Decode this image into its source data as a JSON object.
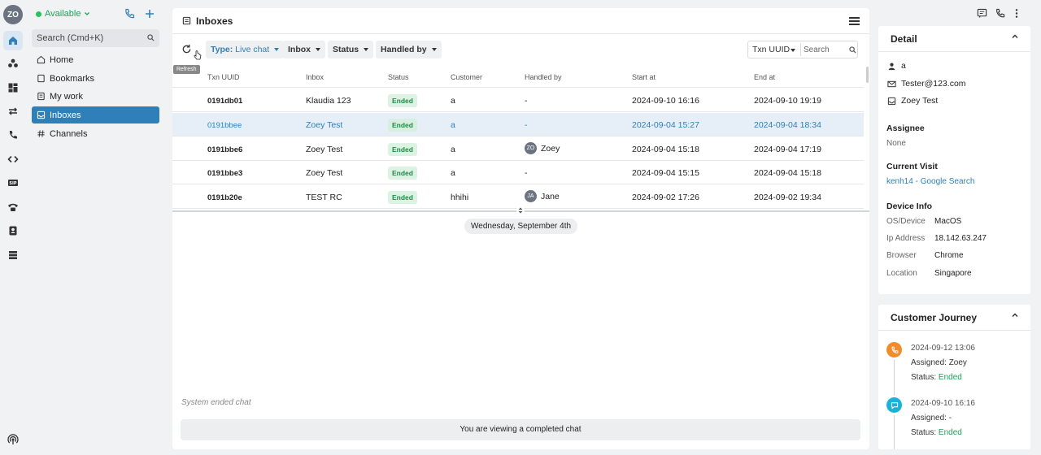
{
  "user": {
    "initials": "ZO",
    "status": "Available"
  },
  "search": {
    "placeholder": "Search (Cmd+K)"
  },
  "nav": {
    "items": [
      {
        "label": "Home",
        "icon": "home-icon"
      },
      {
        "label": "Bookmarks",
        "icon": "bookmark-icon"
      },
      {
        "label": "My work",
        "icon": "briefcase-icon"
      },
      {
        "label": "Inboxes",
        "icon": "inbox-icon"
      },
      {
        "label": "Channels",
        "icon": "hash-icon"
      }
    ]
  },
  "main": {
    "title": "Inboxes",
    "filters": {
      "type_prefix": "Type:",
      "type_value": "Live chat",
      "inbox": "Inbox",
      "status": "Status",
      "handled_by": "Handled by"
    },
    "refresh_tooltip": "Refresh",
    "search_field": {
      "select_label": "Txn UUID",
      "placeholder": "Search"
    },
    "columns": [
      "Txn UUID",
      "Inbox",
      "Status",
      "Customer",
      "Handled by",
      "Start at",
      "End at"
    ],
    "rows": [
      {
        "uuid": "0191db01",
        "inbox": "Klaudia 123",
        "status": "Ended",
        "customer": "a",
        "handled_by": "-",
        "handled_initials": "",
        "start": "2024-09-10 16:16",
        "end": "2024-09-10 19:19"
      },
      {
        "uuid": "0191bbee",
        "inbox": "Zoey Test",
        "status": "Ended",
        "customer": "a",
        "handled_by": "-",
        "handled_initials": "",
        "start": "2024-09-04 15:27",
        "end": "2024-09-04 18:34"
      },
      {
        "uuid": "0191bbe6",
        "inbox": "Zoey Test",
        "status": "Ended",
        "customer": "a",
        "handled_by": "Zoey",
        "handled_initials": "ZO",
        "start": "2024-09-04 15:18",
        "end": "2024-09-04 17:19"
      },
      {
        "uuid": "0191bbe3",
        "inbox": "Zoey Test",
        "status": "Ended",
        "customer": "a",
        "handled_by": "-",
        "handled_initials": "",
        "start": "2024-09-04 15:15",
        "end": "2024-09-04 15:18"
      },
      {
        "uuid": "0191b20e",
        "inbox": "TEST RC",
        "status": "Ended",
        "customer": "hhihi",
        "handled_by": "Jane",
        "handled_initials": "JA",
        "start": "2024-09-02 17:26",
        "end": "2024-09-02 19:34"
      }
    ],
    "date_divider": "Wednesday, September 4th",
    "system_message": "System ended chat",
    "footer_notice": "You are viewing a completed chat"
  },
  "detail": {
    "title": "Detail",
    "name": "a",
    "email": "Tester@123.com",
    "inbox": "Zoey Test",
    "assignee_label": "Assignee",
    "assignee_value": "None",
    "visit_label": "Current Visit",
    "visit_value": "kenh14 - Google Search",
    "device_label": "Device Info",
    "device": [
      {
        "key": "OS/Device",
        "value": "MacOS"
      },
      {
        "key": "Ip Address",
        "value": "18.142.63.247"
      },
      {
        "key": "Browser",
        "value": "Chrome"
      },
      {
        "key": "Location",
        "value": "Singapore"
      }
    ]
  },
  "journey": {
    "title": "Customer Journey",
    "events": [
      {
        "time": "2024-09-12 13:06",
        "assigned_label": "Assigned:",
        "assigned": "Zoey",
        "status_label": "Status:",
        "status": "Ended",
        "icon": "phone-icon",
        "color": "#f08c2c"
      },
      {
        "time": "2024-09-10 16:16",
        "assigned_label": "Assigned:",
        "assigned": "-",
        "status_label": "Status:",
        "status": "Ended",
        "icon": "chat-icon",
        "color": "#19b3d6"
      }
    ]
  },
  "colors": {
    "accent": "#2f7fb8",
    "success": "#21a058",
    "selected_row": "#e6eef7"
  }
}
